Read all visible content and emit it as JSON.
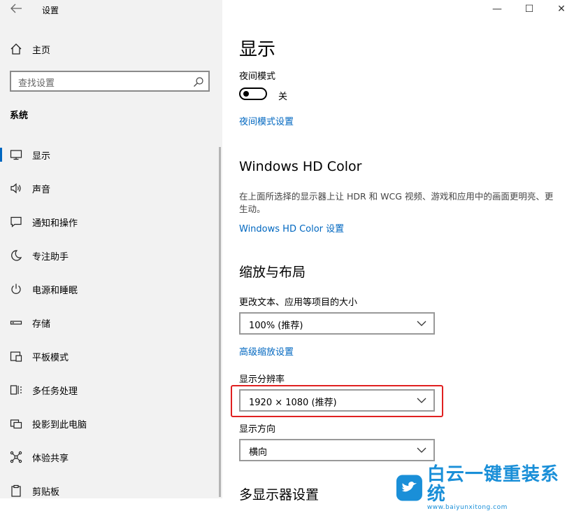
{
  "window": {
    "title": "设置",
    "min": "—",
    "max": "☐",
    "close": "✕"
  },
  "sidebar": {
    "home_label": "主页",
    "search_placeholder": "查找设置",
    "section": "系统",
    "items": [
      {
        "label": "显示",
        "icon": "monitor-icon",
        "active": true
      },
      {
        "label": "声音",
        "icon": "speaker-icon"
      },
      {
        "label": "通知和操作",
        "icon": "notification-icon"
      },
      {
        "label": "专注助手",
        "icon": "moon-icon"
      },
      {
        "label": "电源和睡眠",
        "icon": "power-icon"
      },
      {
        "label": "存储",
        "icon": "storage-icon"
      },
      {
        "label": "平板模式",
        "icon": "tablet-icon"
      },
      {
        "label": "多任务处理",
        "icon": "multitask-icon"
      },
      {
        "label": "投影到此电脑",
        "icon": "project-icon"
      },
      {
        "label": "体验共享",
        "icon": "share-icon"
      },
      {
        "label": "剪贴板",
        "icon": "clipboard-icon"
      }
    ]
  },
  "main": {
    "title": "显示",
    "night_label": "夜间模式",
    "night_state": "关",
    "night_link": "夜间模式设置",
    "hd_title": "Windows HD Color",
    "hd_desc": "在上面所选择的显示器上让 HDR 和 WCG 视频、游戏和应用中的画面更明亮、更生动。",
    "hd_link": "Windows HD Color 设置",
    "scale_title": "缩放与布局",
    "scale_label": "更改文本、应用等项目的大小",
    "scale_value": "100% (推荐)",
    "scale_link": "高级缩放设置",
    "res_label": "显示分辨率",
    "res_value": "1920 × 1080 (推荐)",
    "orient_label": "显示方向",
    "orient_value": "横向",
    "multi_title": "多显示器设置"
  },
  "watermark": {
    "brand": "白云一键重装系统",
    "url": "www.baiyunxitong.com"
  },
  "colors": {
    "accent": "#0067c0",
    "highlight": "#e02020",
    "sidebar_bg": "#f2f2f2",
    "brand": "#1a8fd8"
  }
}
